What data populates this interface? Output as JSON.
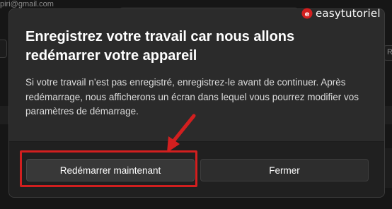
{
  "background": {
    "email_fragment": "piri@gmail.com",
    "right_field_fragment": "R"
  },
  "dialog": {
    "title": "Enregistrez votre travail car nous allons redémarrer votre appareil",
    "body": "Si votre travail n’est pas enregistré, enregistrez-le avant de continuer. Après redémarrage, nous afficherons un écran dans lequel vous pourrez modifier vos paramètres de démarrage.",
    "restart_button_label": "Redémarrer maintenant",
    "close_button_label": "Fermer"
  },
  "watermark": {
    "text": "easytutoriel",
    "icon": "easytutoriel-logo-icon",
    "color": "#d21f1f"
  },
  "annotation": {
    "color": "#d21f1f",
    "highlight_target": "restart-button"
  }
}
